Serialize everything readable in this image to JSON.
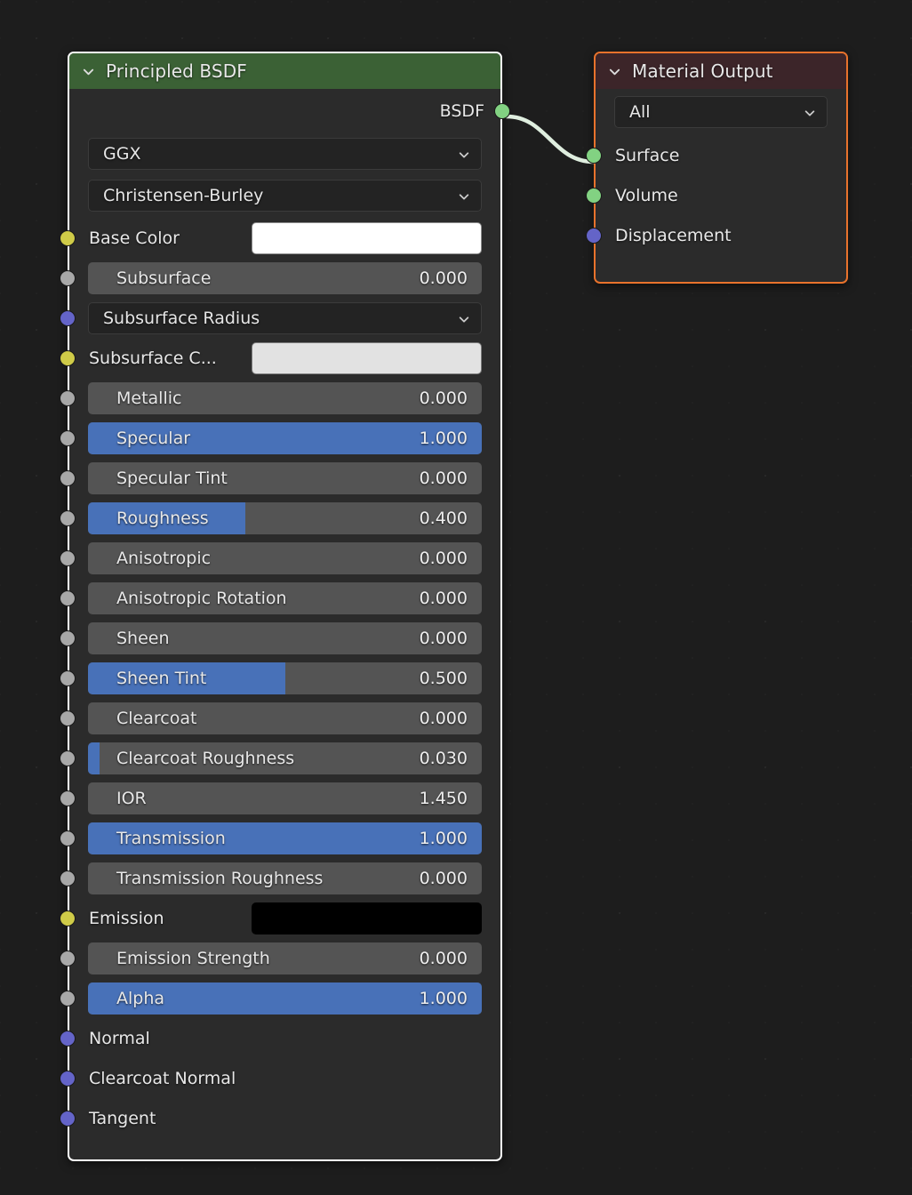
{
  "editor": {
    "name": "Shader Node Editor",
    "background_color": "#1d1d1d"
  },
  "nodes": {
    "principled": {
      "title": "Principled BSDF",
      "header_color": "#3b6135",
      "state": "selected",
      "collapse_icon": "chevron-down-icon",
      "outputs": [
        {
          "label": "BSDF",
          "socket_color": "#82d282",
          "socket_type": "shader"
        }
      ],
      "enums": [
        {
          "name": "distribution",
          "value": "GGX",
          "icon": "chevron-down-icon"
        },
        {
          "name": "subsurface-method",
          "value": "Christensen-Burley",
          "icon": "chevron-down-icon"
        }
      ],
      "inputs": [
        {
          "label": "Base Color",
          "kind": "color",
          "color": "#ffffff",
          "socket_color": "#cfcb48",
          "socket_type": "color"
        },
        {
          "label": "Subsurface",
          "kind": "slider",
          "value": "0.000",
          "fill": 0,
          "socket_color": "#a8a8a8",
          "socket_type": "value"
        },
        {
          "label": "Subsurface Radius",
          "kind": "enum",
          "value": "Subsurface Radius",
          "socket_color": "#6464c8",
          "socket_type": "vector",
          "icon": "chevron-down-icon"
        },
        {
          "label": "Subsurface C...",
          "kind": "color",
          "color": "#e2e2e2",
          "socket_color": "#cfcb48",
          "socket_type": "color"
        },
        {
          "label": "Metallic",
          "kind": "slider",
          "value": "0.000",
          "fill": 0,
          "socket_color": "#a8a8a8",
          "socket_type": "value"
        },
        {
          "label": "Specular",
          "kind": "slider",
          "value": "1.000",
          "fill": 100,
          "socket_color": "#a8a8a8",
          "socket_type": "value"
        },
        {
          "label": "Specular Tint",
          "kind": "slider",
          "value": "0.000",
          "fill": 0,
          "socket_color": "#a8a8a8",
          "socket_type": "value"
        },
        {
          "label": "Roughness",
          "kind": "slider",
          "value": "0.400",
          "fill": 40,
          "socket_color": "#a8a8a8",
          "socket_type": "value"
        },
        {
          "label": "Anisotropic",
          "kind": "slider",
          "value": "0.000",
          "fill": 0,
          "socket_color": "#a8a8a8",
          "socket_type": "value"
        },
        {
          "label": "Anisotropic Rotation",
          "kind": "slider",
          "value": "0.000",
          "fill": 0,
          "socket_color": "#a8a8a8",
          "socket_type": "value"
        },
        {
          "label": "Sheen",
          "kind": "slider",
          "value": "0.000",
          "fill": 0,
          "socket_color": "#a8a8a8",
          "socket_type": "value"
        },
        {
          "label": "Sheen Tint",
          "kind": "slider",
          "value": "0.500",
          "fill": 50,
          "socket_color": "#a8a8a8",
          "socket_type": "value"
        },
        {
          "label": "Clearcoat",
          "kind": "slider",
          "value": "0.000",
          "fill": 0,
          "socket_color": "#a8a8a8",
          "socket_type": "value"
        },
        {
          "label": "Clearcoat Roughness",
          "kind": "slider",
          "value": "0.030",
          "fill": 3,
          "socket_color": "#a8a8a8",
          "socket_type": "value"
        },
        {
          "label": "IOR",
          "kind": "slider",
          "value": "1.450",
          "fill": 0,
          "socket_color": "#a8a8a8",
          "socket_type": "value"
        },
        {
          "label": "Transmission",
          "kind": "slider",
          "value": "1.000",
          "fill": 100,
          "socket_color": "#a8a8a8",
          "socket_type": "value"
        },
        {
          "label": "Transmission Roughness",
          "kind": "slider",
          "value": "0.000",
          "fill": 0,
          "socket_color": "#a8a8a8",
          "socket_type": "value"
        },
        {
          "label": "Emission",
          "kind": "color",
          "color": "#000000",
          "socket_color": "#cfcb48",
          "socket_type": "color"
        },
        {
          "label": "Emission Strength",
          "kind": "slider",
          "value": "0.000",
          "fill": 0,
          "socket_color": "#a8a8a8",
          "socket_type": "value"
        },
        {
          "label": "Alpha",
          "kind": "slider",
          "value": "1.000",
          "fill": 100,
          "socket_color": "#a8a8a8",
          "socket_type": "value"
        },
        {
          "label": "Normal",
          "kind": "vector",
          "socket_color": "#6464c8",
          "socket_type": "vector"
        },
        {
          "label": "Clearcoat Normal",
          "kind": "vector",
          "socket_color": "#6464c8",
          "socket_type": "vector"
        },
        {
          "label": "Tangent",
          "kind": "vector",
          "socket_color": "#6464c8",
          "socket_type": "vector"
        }
      ]
    },
    "material_output": {
      "title": "Material Output",
      "header_color": "#3c2529",
      "border_color": "#e8722c",
      "state": "active",
      "collapse_icon": "chevron-down-icon",
      "target": {
        "name": "target",
        "value": "All",
        "icon": "chevron-down-icon"
      },
      "inputs": [
        {
          "label": "Surface",
          "socket_color": "#82d282",
          "socket_type": "shader"
        },
        {
          "label": "Volume",
          "socket_color": "#82d282",
          "socket_type": "shader"
        },
        {
          "label": "Displacement",
          "socket_color": "#6464c8",
          "socket_type": "vector"
        }
      ]
    }
  },
  "links": [
    {
      "from": "principled.BSDF",
      "to": "material_output.Surface",
      "color": "#dfeedf"
    }
  ]
}
